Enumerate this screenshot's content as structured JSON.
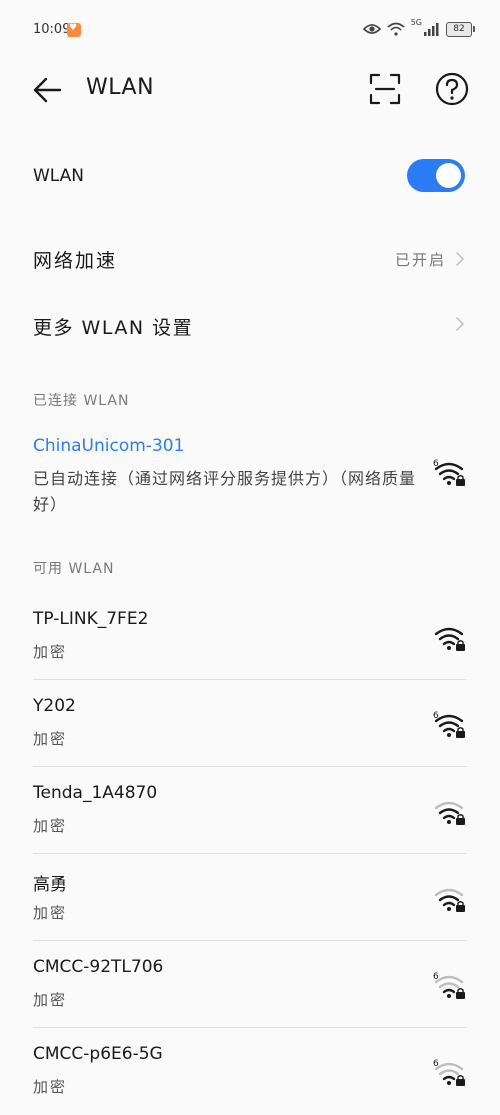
{
  "status_bar": {
    "time": "10:09",
    "battery": "82",
    "network": "5G"
  },
  "header": {
    "title": "WLAN"
  },
  "wlan_toggle": {
    "label": "WLAN",
    "on": true
  },
  "network_accel": {
    "label": "网络加速",
    "value": "已开启"
  },
  "more_settings": {
    "label": "更多 WLAN 设置"
  },
  "connected": {
    "section_label": "已连接 WLAN",
    "name": "ChinaUnicom-301",
    "description": "已自动连接（通过网络评分服务提供方）（网络质量好）"
  },
  "available": {
    "section_label": "可用 WLAN",
    "networks": [
      {
        "name": "TP-LINK_7FE2",
        "security": "加密"
      },
      {
        "name": "Y202",
        "security": "加密"
      },
      {
        "name": "Tenda_1A4870",
        "security": "加密"
      },
      {
        "name": "高勇",
        "security": "加密"
      },
      {
        "name": "CMCC-92TL706",
        "security": "加密"
      },
      {
        "name": "CMCC-p6E6-5G",
        "security": "加密"
      }
    ]
  },
  "colors": {
    "accent": "#2a7df4",
    "background": "#fafafa"
  }
}
